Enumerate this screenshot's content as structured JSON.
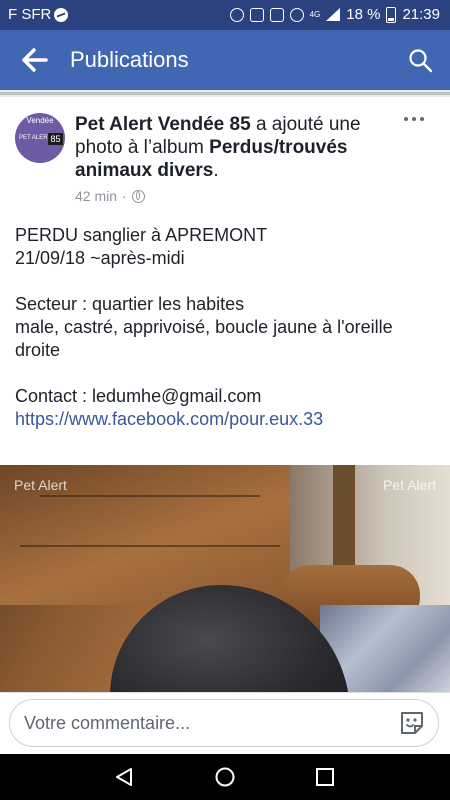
{
  "status_bar": {
    "carrier": "F SFR",
    "network": "4G",
    "battery": "18 %",
    "time": "21:39",
    "icons": [
      "messenger-icon",
      "data-saver-icon",
      "nfc-icon",
      "vibrate-icon",
      "eye-comfort-icon",
      "signal-icon",
      "battery-icon"
    ]
  },
  "app_bar": {
    "title": "Publications",
    "back_icon": "arrow-left-icon",
    "search_icon": "search-icon"
  },
  "post": {
    "page_name": "Pet Alert Vendée 85",
    "action_text": " a ajouté une photo à l’album ",
    "album_name": "Perdus/trouvés animaux divers",
    "action_end": ".",
    "time": "42 min",
    "separator": "·",
    "privacy_icon": "globe-icon",
    "avatar": {
      "line1": "Vendée",
      "line2": "PET ALERT",
      "badge": "85"
    },
    "body": [
      "PERDU sanglier à APREMONT",
      "21/09/18 ~après-midi",
      "",
      "Secteur : quartier les habites",
      "male, castré, apprivoisé, boucle jaune à l'oreille droite",
      "",
      "Contact : ledumhe@gmail.com"
    ],
    "link": "https://www.facebook.com/pour.eux.33",
    "photo_watermark": "Pet Alert"
  },
  "comment": {
    "placeholder": "Votre commentaire...",
    "sticker_icon": "sticker-icon"
  },
  "nav_bar": {
    "icons": [
      "back-triangle-icon",
      "home-circle-icon",
      "recent-apps-square-icon"
    ]
  },
  "colors": {
    "status_bar": "#2c4280",
    "app_bar": "#4267b2",
    "link": "#385898",
    "text": "#1d2129",
    "meta": "#90949c"
  }
}
